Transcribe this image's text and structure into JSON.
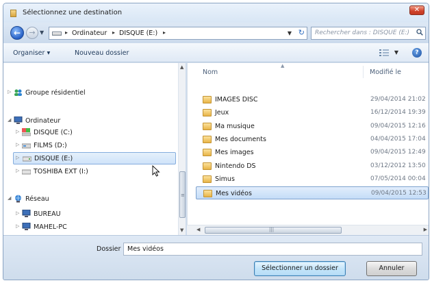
{
  "window": {
    "title": "Sélectionnez une destination",
    "close_label": "✕"
  },
  "address": {
    "segments": [
      "Ordinateur",
      "DISQUE (E:)"
    ],
    "search_placeholder": "Rechercher dans : DISQUE (E:)"
  },
  "toolbar": {
    "organize_label": "Organiser ▾",
    "new_folder_label": "Nouveau dossier",
    "help_label": "?"
  },
  "nav": {
    "items": [
      {
        "label": "Groupe résidentiel",
        "icon": "homegroup-icon",
        "expander": "▷"
      },
      {
        "label": "Ordinateur",
        "icon": "computer-icon",
        "expander": "◢"
      },
      {
        "label": "DISQUE (C:)",
        "icon": "system-drive-icon",
        "expander": "▷"
      },
      {
        "label": "FILMS (D:)",
        "icon": "drive-icon",
        "expander": "▷"
      },
      {
        "label": "DISQUE (E:)",
        "icon": "drive-icon",
        "expander": "▷",
        "selected": true
      },
      {
        "label": "TOSHIBA EXT (I:)",
        "icon": "drive-icon",
        "expander": "▷"
      },
      {
        "label": "Réseau",
        "icon": "network-icon",
        "expander": "◢"
      },
      {
        "label": "BUREAU",
        "icon": "computer-icon",
        "expander": "▷"
      },
      {
        "label": "MAHEL-PC",
        "icon": "computer-icon",
        "expander": "▷"
      }
    ]
  },
  "files": {
    "columns": {
      "name": "Nom",
      "modified": "Modifié le"
    },
    "rows": [
      {
        "name": "IMAGES DISC",
        "date": "29/04/2014 21:02"
      },
      {
        "name": "Jeux",
        "date": "16/12/2014 19:39"
      },
      {
        "name": "Ma musique",
        "date": "09/04/2015 12:16"
      },
      {
        "name": "Mes documents",
        "date": "04/04/2015 17:04"
      },
      {
        "name": "Mes images",
        "date": "09/04/2015 12:49"
      },
      {
        "name": "Nintendo DS",
        "date": "03/12/2012 13:50"
      },
      {
        "name": "Simus",
        "date": "07/05/2014 00:04"
      },
      {
        "name": "Mes vidéos",
        "date": "09/04/2015 12:53",
        "selected": true
      }
    ]
  },
  "bottom": {
    "folder_label": "Dossier :",
    "folder_value": "Mes vidéos",
    "select_button": "Sélectionner un dossier",
    "cancel_button": "Annuler"
  },
  "colors": {
    "selection": "#cfe3f9",
    "selection_border": "#84acdd",
    "folder": "#e8b447"
  }
}
